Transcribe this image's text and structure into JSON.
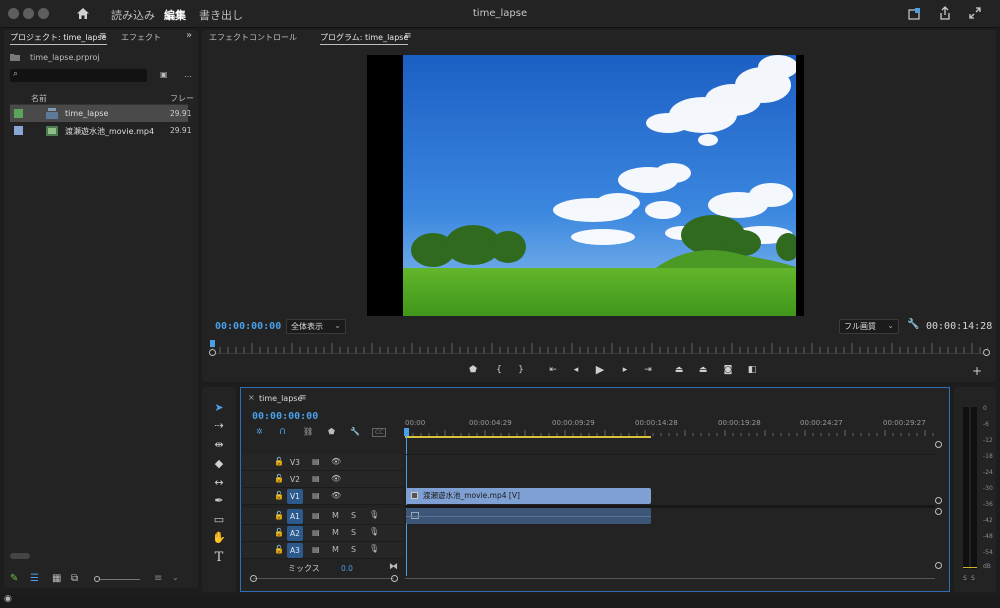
{
  "titlebar": {
    "tabs": [
      "読み込み",
      "編集",
      "書き出し"
    ],
    "active_tab": "編集",
    "document_title": "time_lapse"
  },
  "project_panel": {
    "tabs": [
      "プロジェクト: time_lapse",
      "エフェクト"
    ],
    "project_file": "time_lapse.prproj",
    "search_placeholder": "",
    "columns": [
      "名前",
      "フレー"
    ],
    "items": [
      {
        "name": "time_lapse",
        "rate": "29.91",
        "color": "#5aa55a",
        "selected": true
      },
      {
        "name": "渡瀬遊水池_movie.mp4",
        "rate": "29.91",
        "color": "#8aa6d6",
        "selected": false
      }
    ]
  },
  "monitor": {
    "tabs": [
      "エフェクトコントロール",
      "プログラム: time_lapse"
    ],
    "timecode_current": "00:00:00:00",
    "zoom": "全体表示",
    "quality": "フル画質",
    "timecode_duration": "00:00:14:28"
  },
  "transport": [
    "marker",
    "in",
    "out",
    "go-in",
    "step-back",
    "play",
    "step-forward",
    "go-out",
    "lift",
    "extract",
    "export-frame",
    "compare"
  ],
  "timeline": {
    "sequence_tab": "time_lapse",
    "timecode": "00:00:00:00",
    "ruler": [
      "00:00",
      "00:00:04:29",
      "00:00:09:29",
      "00:00:14:28",
      "00:00:19:28",
      "00:00:24:27",
      "00:00:29:27"
    ],
    "video_tracks": [
      "V3",
      "V2",
      "V1"
    ],
    "audio_tracks": [
      "A1",
      "A2",
      "A3"
    ],
    "audio_controls": [
      "M",
      "S"
    ],
    "mix_label": "ミックス",
    "mix_value": "0.0",
    "clip_video": "渡瀬遊水池_movie.mp4 [V]",
    "clip_audio": ""
  },
  "meters": {
    "scale": [
      "0",
      "-6",
      "-12",
      "-18",
      "-24",
      "-30",
      "-36",
      "-42",
      "-48",
      "-54",
      "dB"
    ],
    "solo": [
      "S",
      "S"
    ]
  },
  "colors": {
    "accent_blue": "#4a9fe8",
    "clip_video": "#7fa0d2",
    "clip_audio": "#3d5576",
    "selection": "#2c5a8c"
  }
}
